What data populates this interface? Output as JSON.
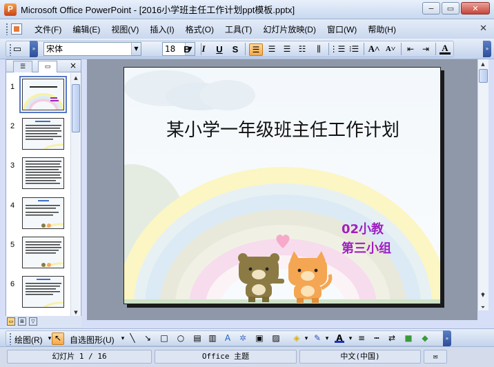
{
  "window": {
    "title": "Microsoft Office PowerPoint - [2016小学班主任工作计划ppt模板.pptx]",
    "minimize": "−",
    "restore": "▭",
    "close": "✕"
  },
  "menu": {
    "items": [
      "文件(F)",
      "编辑(E)",
      "视图(V)",
      "插入(I)",
      "格式(O)",
      "工具(T)",
      "幻灯片放映(D)",
      "窗口(W)",
      "帮助(H)"
    ],
    "close": "✕"
  },
  "format_toolbar": {
    "font_name": "宋体",
    "font_size": "18",
    "bold": "B",
    "italic": "I",
    "underline": "U",
    "shadow": "S"
  },
  "left_pane": {
    "close": "×",
    "slide_numbers": [
      "1",
      "2",
      "3",
      "4",
      "5",
      "6"
    ],
    "selected_index": 0
  },
  "slide": {
    "title": "某小学一年级班主任工作计划",
    "subtitle_line1": "02小教",
    "subtitle_line2": "第三小组",
    "accent_text_color": "#a020c0"
  },
  "draw_toolbar": {
    "draw_label": "绘图(R)",
    "autoshape_label": "自选图形(U)"
  },
  "status_bar": {
    "slide_position": "幻灯片 1 / 16",
    "theme": "Office 主题",
    "language": "中文(中国)"
  }
}
